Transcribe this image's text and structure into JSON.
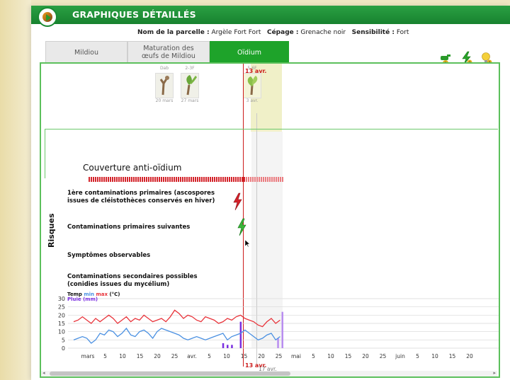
{
  "window": {
    "title": "GRAPHIQUES DÉTAILLÉS"
  },
  "parcel": {
    "name_label": "Nom de la parcelle :",
    "name": "Argèle Fort Fort",
    "cepage_label": "Cépage :",
    "cepage": "Grenache noir",
    "sens_label": "Sensibilité :",
    "sens": "Fort"
  },
  "tabs": [
    {
      "label": "Mildiou"
    },
    {
      "label": "Maturation des œufs de Mildiou"
    },
    {
      "label": "Oïdium"
    }
  ],
  "stages": [
    {
      "code": "Dab",
      "date": "20 mars"
    },
    {
      "code": "2-3F",
      "date": "27 mars"
    },
    {
      "code": "5-6F",
      "date": "3 avr."
    }
  ],
  "markers": {
    "today": "13 avr.",
    "forecast": "17 avr."
  },
  "coverage": {
    "title": "Couverture anti-oïdium"
  },
  "risks": {
    "axis": "Risques",
    "r1": "1ère contaminations primaires (ascospores issues de cléistothèces conservés en hiver)",
    "r2": "Contaminations primaires suivantes",
    "r3": "Symptômes observables",
    "r4": "Contaminations secondaires possibles (conidies issues du mycélium)"
  },
  "colors": {
    "green": "#1ea32a",
    "red": "#cc1b1b",
    "blue": "#4a90e2",
    "purple": "#7a2ee0"
  },
  "chart_data": {
    "type": "line",
    "legend": {
      "temp": "Temp",
      "min": "min",
      "max": "max",
      "unit": "(°C)",
      "rain": "Pluie (mm)"
    },
    "ylim": [
      0,
      30
    ],
    "yticks": [
      0,
      5,
      10,
      15,
      20,
      25,
      30
    ],
    "xticks": [
      "mars",
      "5",
      "10",
      "15",
      "20",
      "25",
      "avr.",
      "5",
      "10",
      "15",
      "20",
      "25",
      "mai",
      "5",
      "10",
      "15",
      "20",
      "25",
      "juin",
      "5",
      "10",
      "15",
      "20"
    ],
    "series": [
      {
        "name": "max",
        "color": "#e8333a",
        "values": [
          16,
          17,
          19,
          17,
          15,
          18,
          16,
          18,
          20,
          18,
          15,
          17,
          19,
          16,
          18,
          17,
          20,
          18,
          16,
          17,
          18,
          16,
          19,
          23,
          21,
          18,
          20,
          19,
          17,
          16,
          19,
          18,
          17,
          15,
          16,
          18,
          17,
          19,
          20,
          18,
          17,
          16,
          14,
          13,
          16,
          18,
          15,
          17
        ]
      },
      {
        "name": "min",
        "color": "#4a90e2",
        "values": [
          5,
          6,
          7,
          6,
          3,
          5,
          9,
          8,
          11,
          10,
          7,
          9,
          12,
          8,
          7,
          10,
          11,
          9,
          6,
          10,
          12,
          11,
          10,
          9,
          8,
          6,
          5,
          6,
          7,
          6,
          5,
          6,
          7,
          8,
          9,
          5,
          7,
          8,
          9,
          11,
          9,
          7,
          5,
          6,
          8,
          9,
          5,
          7
        ]
      },
      {
        "name": "Pluie (mm)",
        "color": "#7a2ee0",
        "values": [
          0,
          0,
          0,
          0,
          0,
          0,
          0,
          0,
          0,
          0,
          0,
          0,
          0,
          0,
          0,
          0,
          0,
          0,
          0,
          0,
          0,
          0,
          0,
          0,
          0,
          0,
          0,
          0,
          0,
          0,
          0,
          0,
          0,
          0,
          3,
          2,
          2,
          0,
          16,
          0,
          0,
          0,
          0,
          0,
          0,
          0,
          0,
          0
        ]
      }
    ]
  }
}
